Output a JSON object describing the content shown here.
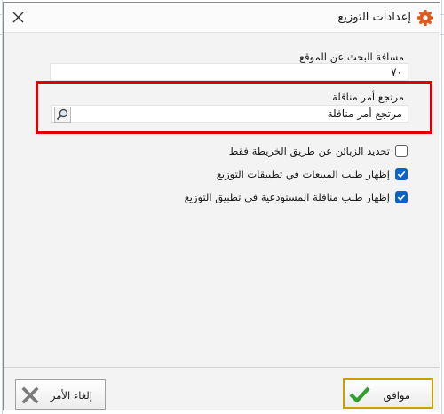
{
  "dialog": {
    "title": "إعدادات التوزيع",
    "icons": {
      "title": "gear-icon",
      "close": "close-icon"
    }
  },
  "search_distance": {
    "label": "مسافة البحث عن الموقع",
    "value": "٧٠"
  },
  "transfer_ref": {
    "label": "مرتجع أمر مناقلة",
    "value": "مرتجع أمر مناقلة",
    "icon": "search-icon",
    "highlight_color": "#e10000"
  },
  "options": {
    "map_only": {
      "label": "تحديد الزبائن عن طريق الخريطة فقط",
      "checked": false
    },
    "show_sales_request": {
      "label": "إظهار طلب المبيعات في تطبيقات التوزيع",
      "checked": true
    },
    "show_warehouse_transfer": {
      "label": "إظهار طلب مناقلة المستودعية في تطبيق التوزيع",
      "checked": true
    }
  },
  "footer": {
    "ok_label": "موافق",
    "cancel_label": "إلغاء الأمر",
    "ok_icon": "checkmark-icon",
    "cancel_icon": "x-icon"
  },
  "colors": {
    "accent": "#0a64c8",
    "ok_border": "#c8a100"
  }
}
